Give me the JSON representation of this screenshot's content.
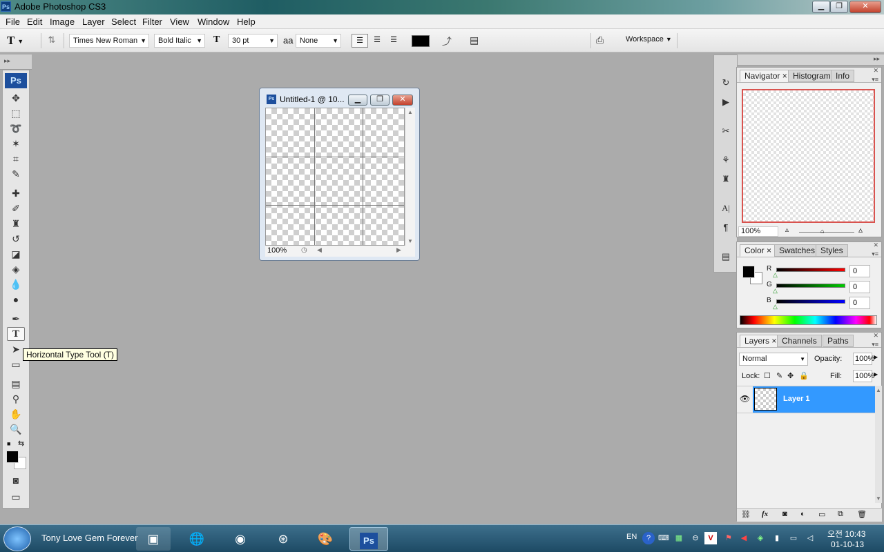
{
  "window": {
    "title": "Adobe Photoshop CS3",
    "app_badge": "Ps"
  },
  "menu": [
    "File",
    "Edit",
    "Image",
    "Layer",
    "Select",
    "Filter",
    "View",
    "Window",
    "Help"
  ],
  "options": {
    "font_family": "Times New Roman",
    "font_style": "Bold Italic",
    "font_size": "30 pt",
    "antialias_label": "a",
    "antialias": "None",
    "workspace": "Workspace"
  },
  "toolbox": {
    "logo": "Ps",
    "tooltip": "Horizontal Type Tool (T)"
  },
  "document": {
    "title": "Untitled-1 @ 10...",
    "zoom": "100%"
  },
  "navigator": {
    "tabs": [
      "Navigator",
      "Histogram",
      "Info"
    ],
    "zoom": "100%"
  },
  "color_panel": {
    "tabs": [
      "Color",
      "Swatches",
      "Styles"
    ],
    "channels": [
      {
        "label": "R",
        "value": "0"
      },
      {
        "label": "G",
        "value": "0"
      },
      {
        "label": "B",
        "value": "0"
      }
    ]
  },
  "layers_panel": {
    "tabs": [
      "Layers",
      "Channels",
      "Paths"
    ],
    "blend_mode": "Normal",
    "opacity_label": "Opacity:",
    "opacity": "100%",
    "lock_label": "Lock:",
    "fill_label": "Fill:",
    "fill": "100%",
    "layers": [
      {
        "name": "Layer 1",
        "selected": true
      }
    ]
  },
  "taskbar": {
    "task_label": "Tony Love Gem Forever",
    "lang": "EN",
    "time": "오전 10:43",
    "date": "01-10-13"
  }
}
